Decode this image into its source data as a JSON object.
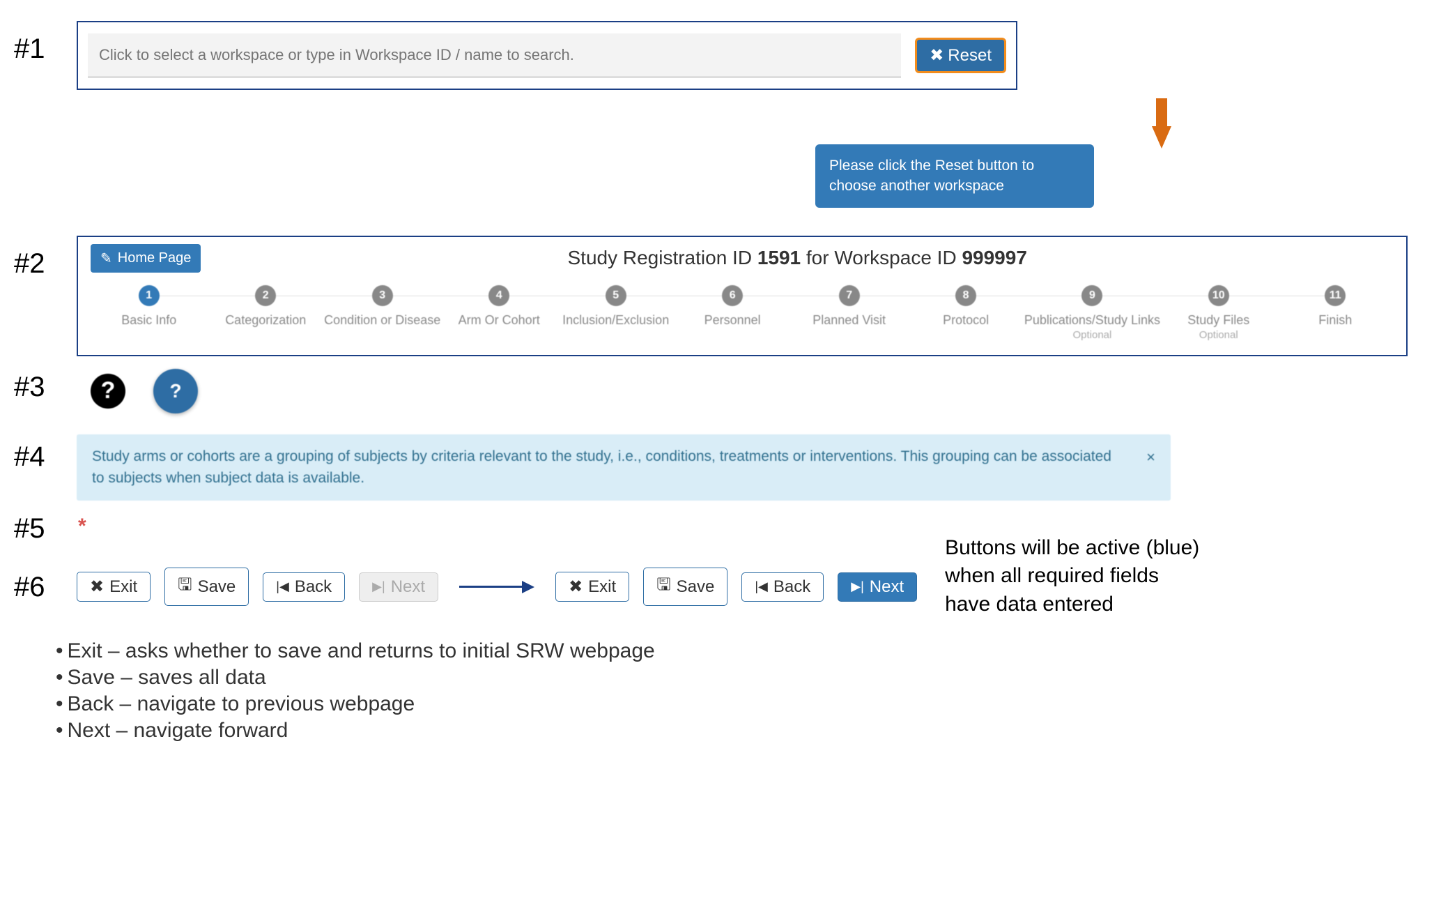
{
  "labels": {
    "n1": "#1",
    "n2": "#2",
    "n3": "#3",
    "n4": "#4",
    "n5": "#5",
    "n6": "#6"
  },
  "search": {
    "placeholder": "Click to select a workspace or type in Workspace ID / name to search.",
    "reset_label": "Reset",
    "tooltip": "Please click the Reset button to choose another workspace"
  },
  "reg": {
    "home_label": "Home Page",
    "title_prefix": "Study Registration ID ",
    "title_id": "1591",
    "title_mid": " for Workspace ID ",
    "ws_id": "999997",
    "steps": [
      {
        "num": "1",
        "label": "Basic Info",
        "sub": "",
        "active": true
      },
      {
        "num": "2",
        "label": "Categorization",
        "sub": ""
      },
      {
        "num": "3",
        "label": "Condition or Disease",
        "sub": ""
      },
      {
        "num": "4",
        "label": "Arm Or Cohort",
        "sub": ""
      },
      {
        "num": "5",
        "label": "Inclusion/Exclusion",
        "sub": ""
      },
      {
        "num": "6",
        "label": "Personnel",
        "sub": ""
      },
      {
        "num": "7",
        "label": "Planned Visit",
        "sub": ""
      },
      {
        "num": "8",
        "label": "Protocol",
        "sub": ""
      },
      {
        "num": "9",
        "label": "Publications/Study Links",
        "sub": "Optional"
      },
      {
        "num": "10",
        "label": "Study Files",
        "sub": "Optional"
      },
      {
        "num": "11",
        "label": "Finish",
        "sub": ""
      }
    ]
  },
  "help": {
    "q": "?"
  },
  "alert": {
    "text": "Study arms or cohorts are a grouping of subjects by criteria relevant to the study, i.e., conditions, treatments or interventions. This grouping can be associated to subjects when subject data is available.",
    "close": "×"
  },
  "star": "*",
  "buttons": {
    "exit": "Exit",
    "save": "Save",
    "back": "Back",
    "next": "Next"
  },
  "note_right_l1": "Buttons will be active (blue)",
  "note_right_l2": "when all required fields",
  "note_right_l3": "have data entered",
  "bullets": [
    "Exit – asks whether to save and returns to initial SRW webpage",
    "Save – saves all data",
    "Back – navigate to previous webpage",
    "Next – navigate forward"
  ],
  "icons": {
    "x": "✖",
    "save": "🖫",
    "back_bar": "|◀",
    "next_bar": "▶|",
    "edit": "✎"
  }
}
